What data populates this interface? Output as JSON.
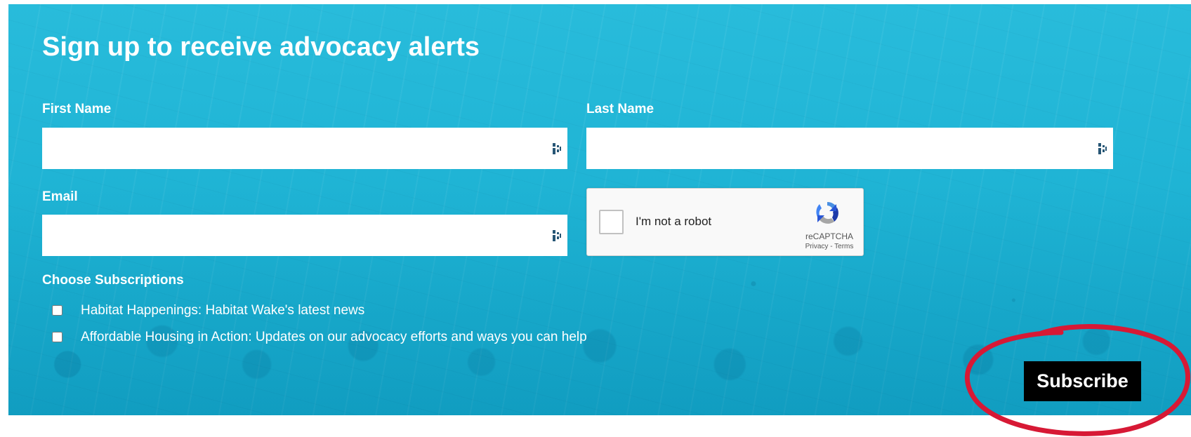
{
  "form": {
    "title": "Sign up to receive advocacy alerts",
    "fields": {
      "first_name": {
        "label": "First Name",
        "value": "",
        "placeholder": ""
      },
      "last_name": {
        "label": "Last Name",
        "value": "",
        "placeholder": ""
      },
      "email": {
        "label": "Email",
        "value": "",
        "placeholder": ""
      }
    },
    "recaptcha": {
      "checkbox_label": "I'm not a robot",
      "brand": "reCAPTCHA",
      "privacy_link": "Privacy",
      "separator": "-",
      "terms_link": "Terms"
    },
    "subscriptions": {
      "label": "Choose Subscriptions",
      "options": [
        {
          "label": "Habitat Happenings: Habitat Wake's latest news",
          "checked": false
        },
        {
          "label": "Affordable Housing in Action: Updates on our advocacy efforts and ways you can help",
          "checked": false
        }
      ]
    },
    "submit_label": "Subscribe"
  },
  "icons": {
    "input_icon": "password-manager-icon",
    "recaptcha_logo": "recaptcha-logo-icon"
  },
  "colors": {
    "panel_background": "#16b6d8",
    "title_text": "#ffffff",
    "input_background": "#ffffff",
    "button_background": "#000000",
    "annotation_circle": "#d71935"
  }
}
